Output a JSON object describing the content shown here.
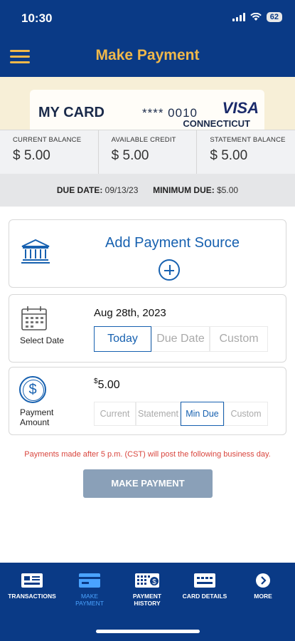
{
  "status_bar": {
    "time": "10:30",
    "battery": "62"
  },
  "header": {
    "title": "Make Payment"
  },
  "card": {
    "name": "MY CARD",
    "number": "**** 0010",
    "network": "VISA",
    "issuer": "CONNECTICUT"
  },
  "balances": [
    {
      "label": "CURRENT BALANCE",
      "value": "$ 5.00"
    },
    {
      "label": "AVAILABLE CREDIT",
      "value": "$ 5.00"
    },
    {
      "label": "STATEMENT BALANCE",
      "value": "$ 5.00"
    }
  ],
  "due": {
    "due_date_label": "DUE DATE:",
    "due_date": "09/13/23",
    "min_due_label": "MINIMUM DUE:",
    "min_due": "$5.00"
  },
  "payment_source": {
    "label": "Add Payment Source"
  },
  "select_date": {
    "caption": "Select Date",
    "value": "Aug 28th, 2023",
    "options": [
      "Today",
      "Due Date",
      "Custom"
    ],
    "selected": "Today"
  },
  "payment_amount": {
    "caption_line1": "Payment",
    "caption_line2": "Amount",
    "currency_symbol": "$",
    "value": "5.00",
    "options": [
      "Current",
      "Statement",
      "Min Due",
      "Custom"
    ],
    "selected": "Min Due"
  },
  "notice": "Payments made after 5 p.m. (CST) will post the following business day.",
  "submit_label": "MAKE PAYMENT",
  "nav": [
    {
      "line1": "TRANSACTIONS",
      "line2": ""
    },
    {
      "line1": "MAKE",
      "line2": "PAYMENT"
    },
    {
      "line1": "PAYMENT",
      "line2": "HISTORY"
    },
    {
      "line1": "CARD DETAILS",
      "line2": ""
    },
    {
      "line1": "MORE",
      "line2": ""
    }
  ],
  "colors": {
    "header_bg": "#0a3a86",
    "accent": "#f0b84a",
    "link_blue": "#1761b0",
    "notice_red": "#d9463e",
    "button_bg": "#8aa0b8"
  }
}
